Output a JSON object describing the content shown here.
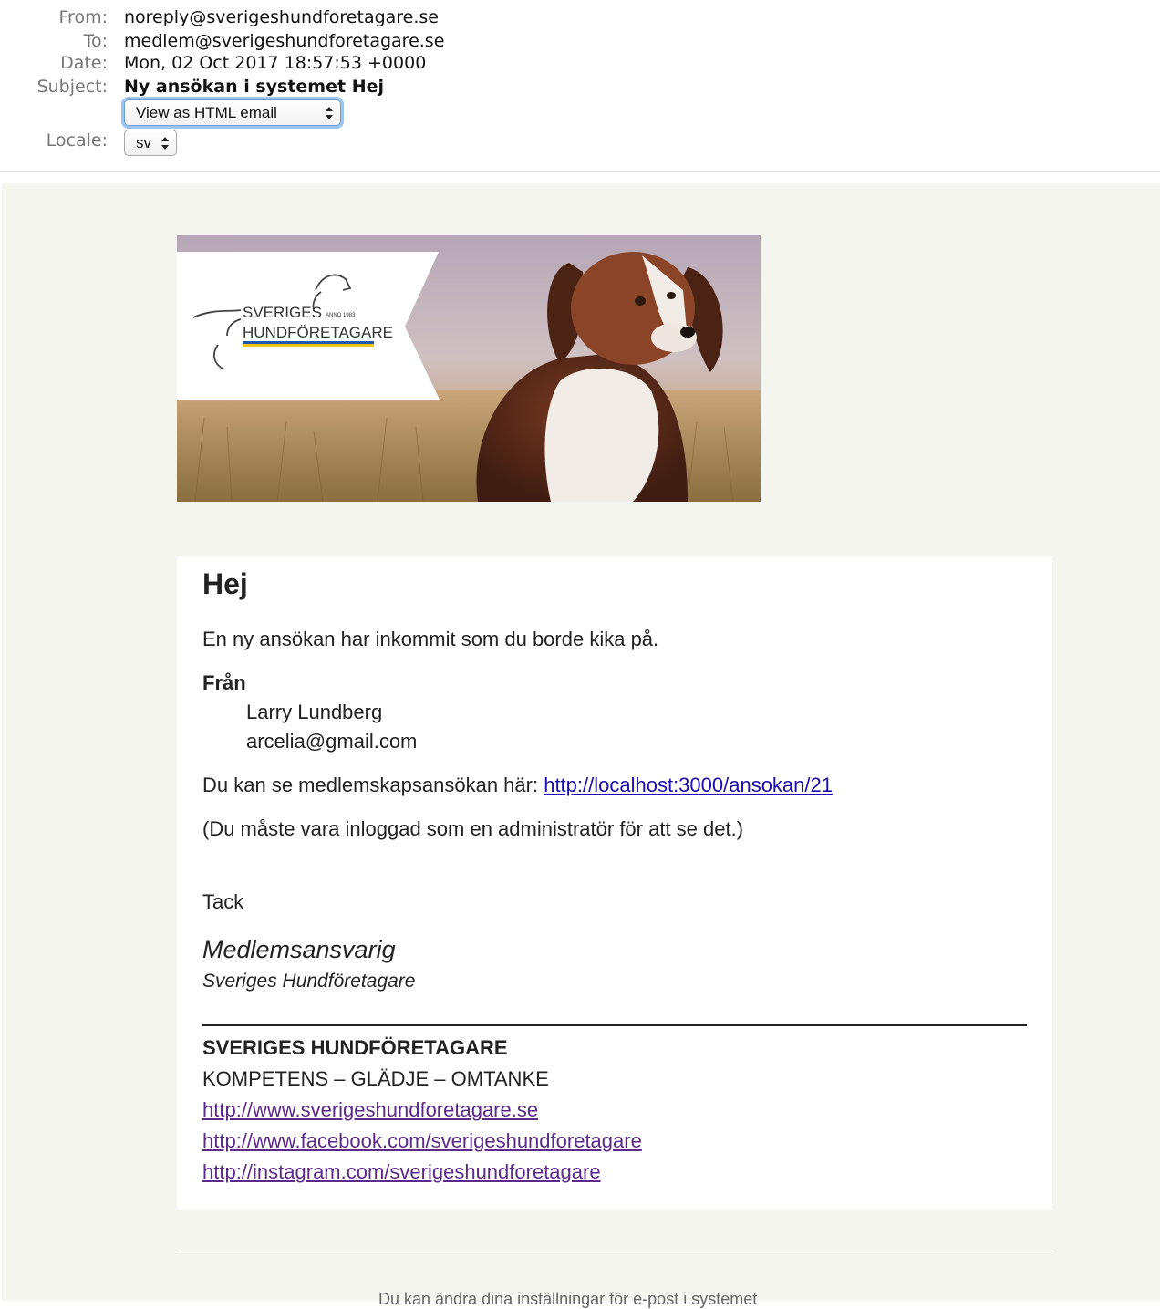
{
  "header": {
    "from_label": "From:",
    "from_value": "noreply@sverigeshundforetagare.se",
    "to_label": "To:",
    "to_value": "medlem@sverigeshundforetagare.se",
    "date_label": "Date:",
    "date_value": "Mon, 02 Oct 2017 18:57:53 +0000",
    "subject_label": "Subject:",
    "subject_value": "Ny ansökan i systemet Hej",
    "view_select": "View as HTML email",
    "locale_label": "Locale:",
    "locale_select": "sv"
  },
  "banner": {
    "logo_line1": "SVERIGES",
    "logo_line2": "HUNDFÖRETAGARE",
    "logo_anno": "ANNO 1983",
    "flag_colors": [
      "#1f5aa6",
      "#f2c318"
    ]
  },
  "body": {
    "greeting": "Hej",
    "intro": "En ny ansökan har inkommit som du borde kika på.",
    "from_heading": "Från",
    "applicant_name": "Larry Lundberg",
    "applicant_email": "arcelia@gmail.com",
    "link_prefix": "Du kan se medlemskapsansökan här: ",
    "application_link": "http://localhost:3000/ansokan/21",
    "admin_note": "(Du måste vara inloggad som en administratör för att se det.)",
    "thanks": "Tack",
    "signature_title": "Medlemsansvarig",
    "signature_org": "Sveriges Hundföretagare"
  },
  "footer": {
    "org_name": "SVERIGES HUNDFÖRETAGARE",
    "tagline": "KOMPETENS – GLÄDJE – OMTANKE",
    "links": [
      "http://www.sverigeshundforetagare.se",
      "http://www.facebook.com/sverigeshundforetagare",
      "http://instagram.com/sverigeshundforetagare"
    ],
    "cut_off_text": "Du kan ändra dina inställningar för e-post i systemet"
  }
}
